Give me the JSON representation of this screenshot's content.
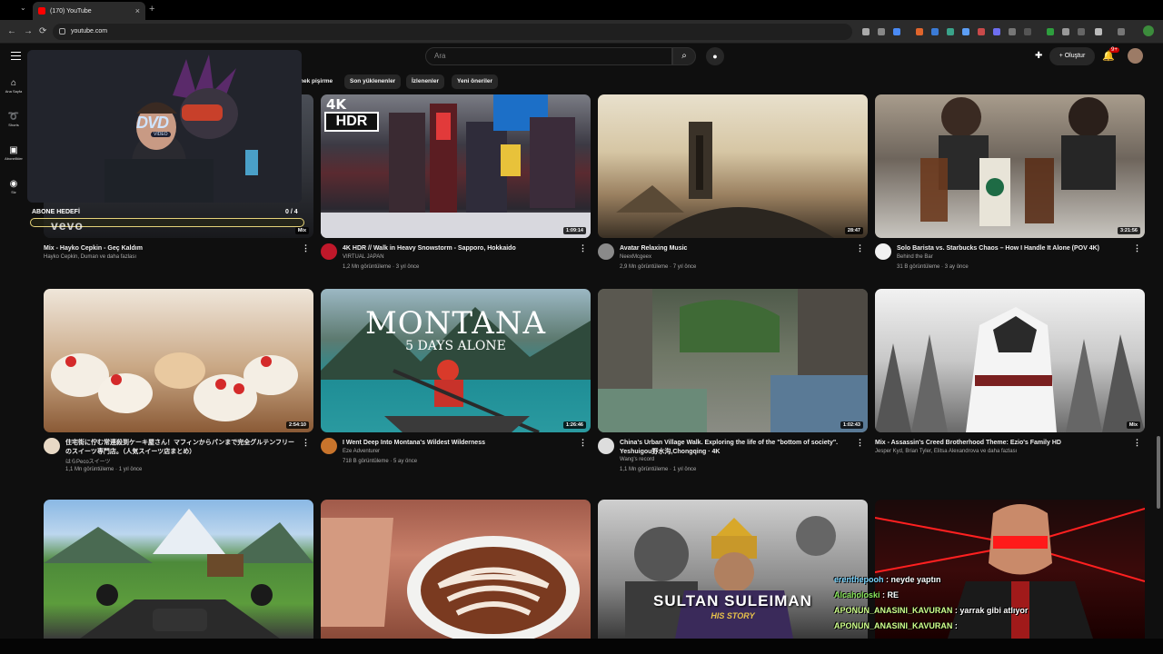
{
  "browser": {
    "tab_title": "(170) YouTube",
    "tab_close": "×",
    "new_tab": "+",
    "url": "youtube.com",
    "back": "←",
    "forward": "→",
    "reload": "⟳"
  },
  "header": {
    "search_placeholder": "Ara",
    "search_icon": "⌕",
    "mic_icon": "🎙",
    "create_label": "+ Oluştur",
    "notification_count": "9+"
  },
  "sidebar": {
    "items": [
      {
        "icon": "⌂",
        "label": "Ana Sayfa"
      },
      {
        "icon": "➰",
        "label": "Shorts"
      },
      {
        "icon": "▣",
        "label": "Abonelikler"
      },
      {
        "icon": "◉",
        "label": "Siz"
      }
    ]
  },
  "chips": [
    "nek pişirme",
    "Son yüklenenler",
    "İzlenenler",
    "Yeni öneriler"
  ],
  "overlay": {
    "dvd": "DVD",
    "dvd_sub": "VIDEO",
    "subscriber_goal_label": "ABONE HEDEFİ",
    "subscriber_goal_count": "0 / 4",
    "vevo": "vevo"
  },
  "videos": [
    {
      "title": "Mix - Hayko Cepkin - Geç Kaldım",
      "channel": "Hayko Cepkin, Duman ve daha fazlası",
      "stats": "",
      "duration": "Mix",
      "avatar_color": "#0f0f0f"
    },
    {
      "title": "4K HDR // Walk in Heavy Snowstorm - Sapporo, Hokkaido",
      "channel": "VIRTUAL JAPAN",
      "stats": "1,2 Mn görüntüleme · 3 yıl önce",
      "duration": "1:09:14",
      "avatar_color": "#c0182a"
    },
    {
      "title": "Avatar Relaxing Music",
      "channel": "NeexMcgeex",
      "stats": "2,9 Mn görüntüleme · 7 yıl önce",
      "duration": "28:47",
      "avatar_color": "#8a8a8a"
    },
    {
      "title": "Solo Barista vs. Starbucks Chaos – How I Handle It Alone (POV 4K)",
      "channel": "Behind the Bar",
      "stats": "31 B görüntüleme · 3 ay önce",
      "duration": "3:21:56",
      "avatar_color": "#f2f2f2"
    },
    {
      "title": "住宅街に佇む常連殺到ケーキ屋さん！マフィンからパンまで完全グルテンフリーのスイーツ専門店。（人気スイーツ店まとめ）",
      "channel": "はらPecoスイーツ",
      "stats": "1,1 Mn görüntüleme · 1 yıl önce",
      "duration": "2:54:10",
      "avatar_color": "#e8d9c5"
    },
    {
      "title": "I Went Deep Into Montana's Wildest Wilderness",
      "channel": "Eze Adventurer",
      "stats": "718 B görüntüleme · 5 ay önce",
      "duration": "1:26:46",
      "avatar_color": "#c8742c"
    },
    {
      "title": "China's Urban Village Walk. Exploring the life of the \"bottom of society\". Yeshuigou野水沟,Chongqing · 4K",
      "channel": "Wang's record",
      "stats": "1,1 Mn görüntüleme · 1 yıl önce",
      "duration": "1:02:43",
      "avatar_color": "#dddddd"
    },
    {
      "title": "Mix - Assassin's Creed Brotherhood Theme: Ezio's Family HD",
      "channel": "Jesper Kyd, Brian Tyler, Elitsa Alexandrova ve daha fazlası",
      "stats": "",
      "duration": "Mix",
      "avatar_color": "#0f0f0f"
    },
    {
      "title": "",
      "channel": "",
      "stats": "",
      "duration": "",
      "avatar_color": "#0f0f0f"
    },
    {
      "title": "",
      "channel": "",
      "stats": "",
      "duration": "",
      "avatar_color": "#0f0f0f"
    },
    {
      "title": "",
      "channel": "",
      "stats": "",
      "duration": "",
      "avatar_color": "#0f0f0f"
    },
    {
      "title": "",
      "channel": "",
      "stats": "",
      "duration": "",
      "avatar_color": "#0f0f0f"
    }
  ],
  "thumb_text": {
    "hdr_4k": "4K",
    "hdr": "HDR",
    "montana": "MONTANA",
    "montana_sub": "5 DAYS ALONE",
    "sultan": "SULTAN SULEIMAN",
    "sultan_sub": "HIS STORY"
  },
  "chat": [
    {
      "user": "erenthepooh",
      "message": ": neyde yaptın"
    },
    {
      "user": "Alcaholoski",
      "message": ": RE"
    },
    {
      "user": "APONUN_ANASINI_KAVURAN",
      "message": ": yarrak gibi atlıyor"
    },
    {
      "user": "APONUN_ANASINI_KAVURAN",
      "message": ":"
    }
  ]
}
